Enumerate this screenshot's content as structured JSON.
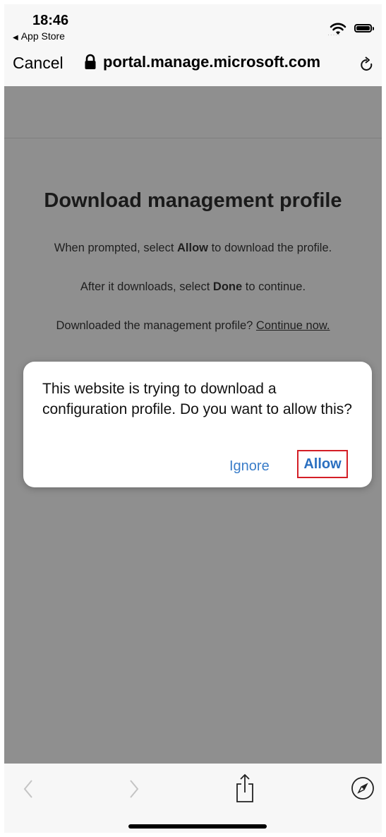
{
  "status_bar": {
    "time": "18:46",
    "back_app_label": "App Store",
    "signal": "....."
  },
  "nav": {
    "cancel_label": "Cancel",
    "address": "portal.manage.microsoft.com"
  },
  "page": {
    "title": "Download management profile",
    "para1": {
      "before": "When prompted, select ",
      "bold": "Allow",
      "after": " to download the profile."
    },
    "para2": {
      "before": "After it downloads, select ",
      "bold": "Done",
      "after": " to continue."
    },
    "para3": {
      "before": "Downloaded the management profile? ",
      "link": "Continue now."
    }
  },
  "alert": {
    "message": "This website is trying to download a configuration profile. Do you want to allow this?",
    "ignore_label": "Ignore",
    "allow_label": "Allow",
    "highlight_color": "#d41f26",
    "button_color": "#2a6fc0"
  },
  "toolbar": {
    "icons": [
      "back-icon",
      "forward-icon",
      "share-icon",
      "compass-icon"
    ]
  }
}
